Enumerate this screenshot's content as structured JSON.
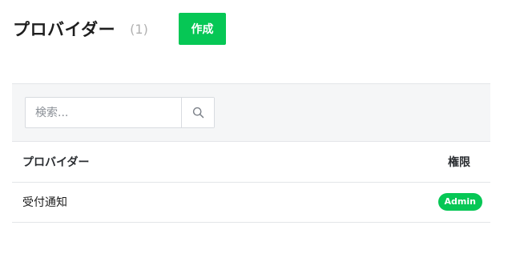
{
  "header": {
    "title": "プロバイダー",
    "count": "(1)",
    "create_label": "作成"
  },
  "search": {
    "placeholder": "検索...",
    "button_icon": "search-icon"
  },
  "table": {
    "columns": [
      "プロバイダー",
      "権限"
    ],
    "rows": [
      {
        "name": "受付通知",
        "role": "Admin"
      }
    ]
  },
  "colors": {
    "accent": "#06c755",
    "filter_bg": "#f5f6f7",
    "border": "#e3e5e8"
  }
}
